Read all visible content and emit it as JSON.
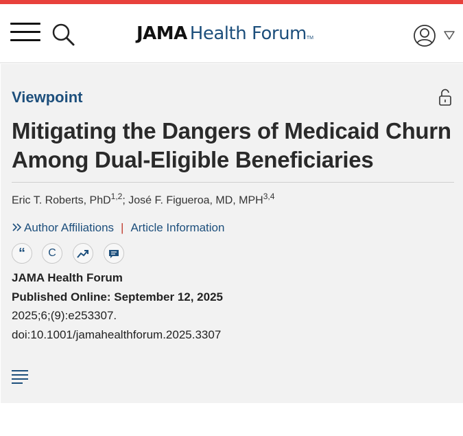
{
  "header": {
    "logo_primary": "JAMA",
    "logo_secondary": "Health Forum",
    "logo_tm": "TM",
    "icons": {
      "menu": "hamburger-menu-icon",
      "search": "search-icon",
      "user": "user-account-icon",
      "caret": "caret-down-icon"
    },
    "accent_color": "#e8413c",
    "brand_color": "#1d4f7c"
  },
  "article": {
    "section": "Viewpoint",
    "title": "Mitigating the Dangers of Medicaid Churn Among Dual-Eligible Beneficiaries",
    "authors": [
      {
        "name": "Eric T. Roberts, PhD",
        "affil": "1,2"
      },
      {
        "name": "José F. Figueroa, MD, MPH",
        "affil": "3,4"
      }
    ],
    "author_separator": "; ",
    "links": {
      "affiliations": "Author Affiliations",
      "article_info": "Article Information",
      "separator": "|"
    },
    "tools": {
      "cite": "“",
      "permissions": "C"
    },
    "journal": "JAMA Health Forum",
    "published": "Published Online: September 12, 2025",
    "citation": "2025;6;(9):e253307.",
    "doi": "doi:10.1001/jamahealthforum.2025.3307"
  }
}
